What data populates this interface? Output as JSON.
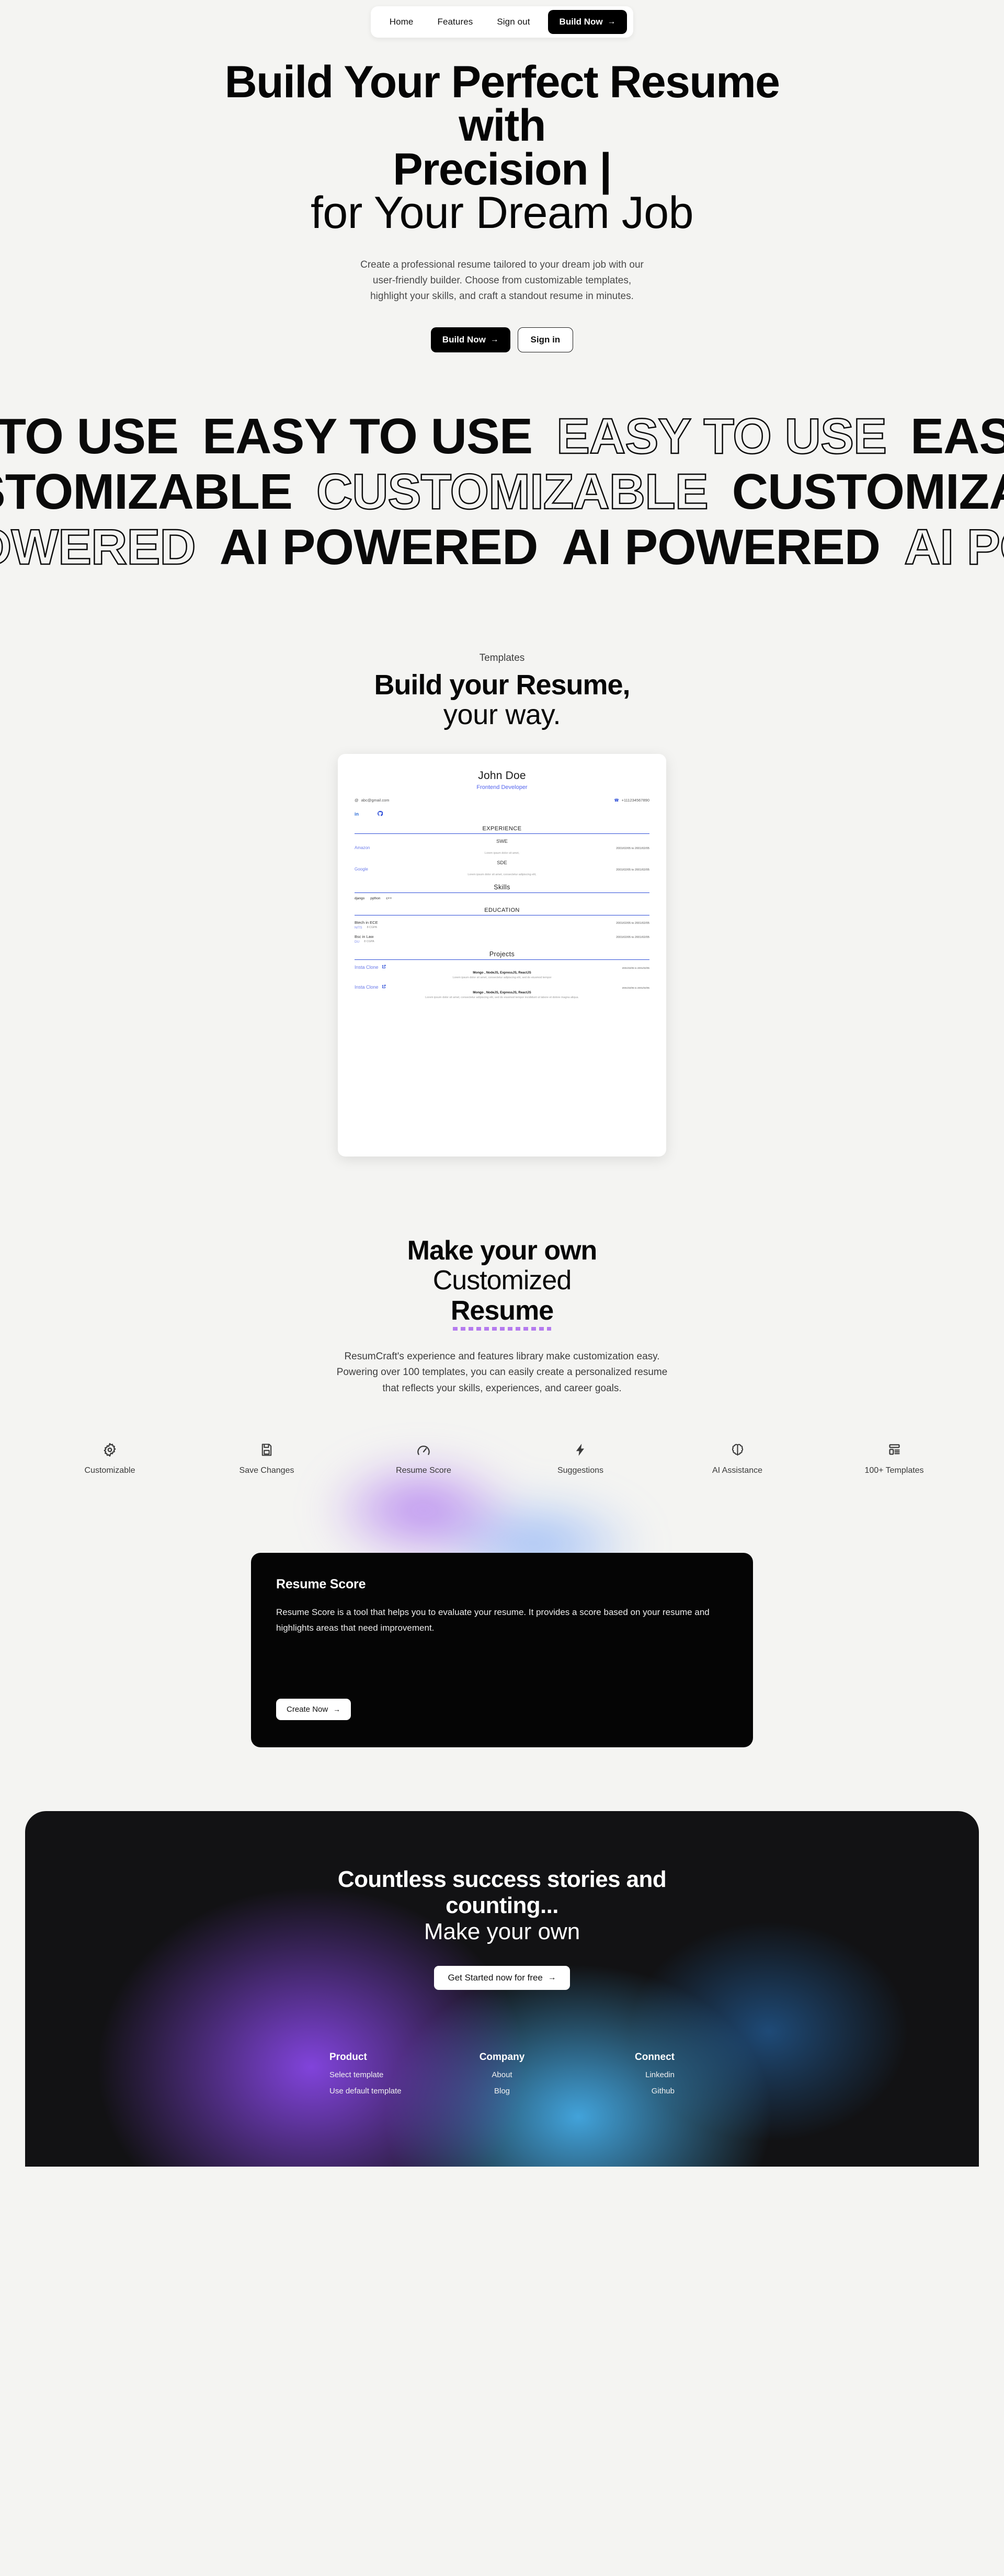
{
  "nav": {
    "links": [
      {
        "label": "Home"
      },
      {
        "label": "Features"
      },
      {
        "label": "Sign out"
      }
    ],
    "cta": "Build Now",
    "cta_arrow": "→"
  },
  "hero": {
    "line1": "Build Your Perfect Resume",
    "line2": "with",
    "line3": "Precision |",
    "line4": "for Your Dream Job",
    "subtitle": "Create a professional resume tailored to your dream job with our user-friendly builder. Choose from customizable templates, highlight your skills, and craft a standout resume in minutes.",
    "primary_cta": "Build Now",
    "secondary_cta": "Sign in",
    "arrow": "→",
    "blob_colors": [
      "#24c5a0",
      "#f46356",
      "#56b8e2"
    ]
  },
  "marquee": {
    "rows": [
      {
        "text": "EASY TO USE",
        "styles": [
          "fill",
          "fill",
          "outline",
          "fill"
        ]
      },
      {
        "text": "CUSTOMIZABLE",
        "styles": [
          "fill",
          "outline",
          "fill",
          "outline"
        ]
      },
      {
        "text": "AI POWERED",
        "styles": [
          "outline",
          "fill",
          "fill",
          "outline"
        ]
      }
    ]
  },
  "templates": {
    "eyebrow": "Templates",
    "heading_bold": "Build your Resume,",
    "heading_thin": "your way."
  },
  "resume": {
    "name": "John Doe",
    "role": "Frontend Developer",
    "email": "abc@gmail.com",
    "email_icon": "at-icon",
    "phone": "+111234567890",
    "phone_icon": "phone-icon",
    "socials": [
      "linkedin-icon",
      "github-icon"
    ],
    "experience": {
      "heading": "EXPERIENCE",
      "items": [
        {
          "title": "SWE",
          "org": "Amazon",
          "date": "2001/02/05 to 2001/02/05",
          "desc": "Lorem ipsum dolor sit amet,"
        },
        {
          "title": "SDE",
          "org": "Google",
          "date": "2001/02/05 to 2001/02/05",
          "desc": "Lorem ipsum dolor sit amet, consectetur adipiscing elit,"
        }
      ]
    },
    "skills": {
      "heading": "Skills",
      "items": [
        "django",
        "python",
        "c++"
      ]
    },
    "education": {
      "heading": "EDUCATION",
      "items": [
        {
          "degree": "Btech in ECE",
          "school": "NITS",
          "gpa": "8 CGPA",
          "date": "2001/02/05 to 2001/02/05"
        },
        {
          "degree": "Bsc in Law",
          "school": "DU",
          "gpa": "8 CGPA",
          "date": "2001/02/05 to 2001/02/05"
        }
      ]
    },
    "projects": {
      "heading": "Projects",
      "items": [
        {
          "title": "Insta Clone",
          "link_icon": "external-link-icon",
          "stack": "Mongo , NodeJS, ExpressJS, ReactJS",
          "date": "2001/02/05 to 2001/02/05",
          "desc": "Lorem ipsum dolor sit amet, consectetur adipiscing elit, sed do eiusmod tempor"
        },
        {
          "title": "Insta Clone",
          "link_icon": "external-link-icon",
          "stack": "Mongo , NodeJS, ExpressJS, ReactJS",
          "date": "2001/02/05 to 2001/02/05",
          "desc": "Lorem ipsum dolor sit amet, consectetur adipiscing elit, sed do eiusmod tempor incididunt ut labore et dolore magna aliqua."
        }
      ]
    },
    "accent_color": "#2f4fd8"
  },
  "customize": {
    "line1": "Make your own",
    "line2": "Customized",
    "line3": "Resume",
    "underline_color": "#b57bee",
    "body": "ResumCraft's experience and features library make customization easy. Powering over 100 templates, you can easily create a personalized resume that reflects your skills, experiences, and career goals."
  },
  "features": [
    {
      "label": "Customizable",
      "icon": "gear-icon"
    },
    {
      "label": "Save Changes",
      "icon": "save-icon"
    },
    {
      "label": "Resume Score",
      "icon": "gauge-icon"
    },
    {
      "label": "Suggestions",
      "icon": "lightning-icon"
    },
    {
      "label": "AI Assistance",
      "icon": "brain-icon"
    },
    {
      "label": "100+ Templates",
      "icon": "layout-icon"
    }
  ],
  "score_card": {
    "title": "Resume Score",
    "body": "Resume Score is a tool that helps you to evaluate your resume. It provides a score based on your resume and highlights areas that need improvement.",
    "cta": "Create Now",
    "arrow": "→",
    "bg": "#050505"
  },
  "footer": {
    "heading_bold": "Countless success stories and counting...",
    "heading_thin": "Make your own",
    "cta": "Get Started now for free",
    "arrow": "→",
    "columns": [
      {
        "title": "Product",
        "links": [
          "Select template",
          "Use default template"
        ]
      },
      {
        "title": "Company",
        "links": [
          "About",
          "Blog"
        ]
      },
      {
        "title": "Connect",
        "links": [
          "Linkedin",
          "Github"
        ]
      }
    ]
  }
}
